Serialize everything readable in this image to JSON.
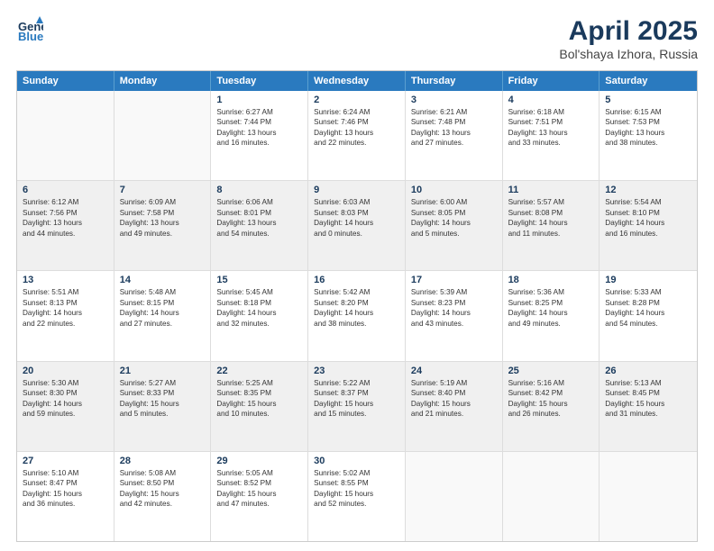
{
  "header": {
    "logo_line1": "General",
    "logo_line2": "Blue",
    "title": "April 2025",
    "subtitle": "Bol'shaya Izhora, Russia"
  },
  "days_of_week": [
    "Sunday",
    "Monday",
    "Tuesday",
    "Wednesday",
    "Thursday",
    "Friday",
    "Saturday"
  ],
  "rows": [
    [
      {
        "day": "",
        "lines": [],
        "empty": true
      },
      {
        "day": "",
        "lines": [],
        "empty": true
      },
      {
        "day": "1",
        "lines": [
          "Sunrise: 6:27 AM",
          "Sunset: 7:44 PM",
          "Daylight: 13 hours",
          "and 16 minutes."
        ]
      },
      {
        "day": "2",
        "lines": [
          "Sunrise: 6:24 AM",
          "Sunset: 7:46 PM",
          "Daylight: 13 hours",
          "and 22 minutes."
        ]
      },
      {
        "day": "3",
        "lines": [
          "Sunrise: 6:21 AM",
          "Sunset: 7:48 PM",
          "Daylight: 13 hours",
          "and 27 minutes."
        ]
      },
      {
        "day": "4",
        "lines": [
          "Sunrise: 6:18 AM",
          "Sunset: 7:51 PM",
          "Daylight: 13 hours",
          "and 33 minutes."
        ]
      },
      {
        "day": "5",
        "lines": [
          "Sunrise: 6:15 AM",
          "Sunset: 7:53 PM",
          "Daylight: 13 hours",
          "and 38 minutes."
        ]
      }
    ],
    [
      {
        "day": "6",
        "lines": [
          "Sunrise: 6:12 AM",
          "Sunset: 7:56 PM",
          "Daylight: 13 hours",
          "and 44 minutes."
        ],
        "shaded": true
      },
      {
        "day": "7",
        "lines": [
          "Sunrise: 6:09 AM",
          "Sunset: 7:58 PM",
          "Daylight: 13 hours",
          "and 49 minutes."
        ],
        "shaded": true
      },
      {
        "day": "8",
        "lines": [
          "Sunrise: 6:06 AM",
          "Sunset: 8:01 PM",
          "Daylight: 13 hours",
          "and 54 minutes."
        ],
        "shaded": true
      },
      {
        "day": "9",
        "lines": [
          "Sunrise: 6:03 AM",
          "Sunset: 8:03 PM",
          "Daylight: 14 hours",
          "and 0 minutes."
        ],
        "shaded": true
      },
      {
        "day": "10",
        "lines": [
          "Sunrise: 6:00 AM",
          "Sunset: 8:05 PM",
          "Daylight: 14 hours",
          "and 5 minutes."
        ],
        "shaded": true
      },
      {
        "day": "11",
        "lines": [
          "Sunrise: 5:57 AM",
          "Sunset: 8:08 PM",
          "Daylight: 14 hours",
          "and 11 minutes."
        ],
        "shaded": true
      },
      {
        "day": "12",
        "lines": [
          "Sunrise: 5:54 AM",
          "Sunset: 8:10 PM",
          "Daylight: 14 hours",
          "and 16 minutes."
        ],
        "shaded": true
      }
    ],
    [
      {
        "day": "13",
        "lines": [
          "Sunrise: 5:51 AM",
          "Sunset: 8:13 PM",
          "Daylight: 14 hours",
          "and 22 minutes."
        ]
      },
      {
        "day": "14",
        "lines": [
          "Sunrise: 5:48 AM",
          "Sunset: 8:15 PM",
          "Daylight: 14 hours",
          "and 27 minutes."
        ]
      },
      {
        "day": "15",
        "lines": [
          "Sunrise: 5:45 AM",
          "Sunset: 8:18 PM",
          "Daylight: 14 hours",
          "and 32 minutes."
        ]
      },
      {
        "day": "16",
        "lines": [
          "Sunrise: 5:42 AM",
          "Sunset: 8:20 PM",
          "Daylight: 14 hours",
          "and 38 minutes."
        ]
      },
      {
        "day": "17",
        "lines": [
          "Sunrise: 5:39 AM",
          "Sunset: 8:23 PM",
          "Daylight: 14 hours",
          "and 43 minutes."
        ]
      },
      {
        "day": "18",
        "lines": [
          "Sunrise: 5:36 AM",
          "Sunset: 8:25 PM",
          "Daylight: 14 hours",
          "and 49 minutes."
        ]
      },
      {
        "day": "19",
        "lines": [
          "Sunrise: 5:33 AM",
          "Sunset: 8:28 PM",
          "Daylight: 14 hours",
          "and 54 minutes."
        ]
      }
    ],
    [
      {
        "day": "20",
        "lines": [
          "Sunrise: 5:30 AM",
          "Sunset: 8:30 PM",
          "Daylight: 14 hours",
          "and 59 minutes."
        ],
        "shaded": true
      },
      {
        "day": "21",
        "lines": [
          "Sunrise: 5:27 AM",
          "Sunset: 8:33 PM",
          "Daylight: 15 hours",
          "and 5 minutes."
        ],
        "shaded": true
      },
      {
        "day": "22",
        "lines": [
          "Sunrise: 5:25 AM",
          "Sunset: 8:35 PM",
          "Daylight: 15 hours",
          "and 10 minutes."
        ],
        "shaded": true
      },
      {
        "day": "23",
        "lines": [
          "Sunrise: 5:22 AM",
          "Sunset: 8:37 PM",
          "Daylight: 15 hours",
          "and 15 minutes."
        ],
        "shaded": true
      },
      {
        "day": "24",
        "lines": [
          "Sunrise: 5:19 AM",
          "Sunset: 8:40 PM",
          "Daylight: 15 hours",
          "and 21 minutes."
        ],
        "shaded": true
      },
      {
        "day": "25",
        "lines": [
          "Sunrise: 5:16 AM",
          "Sunset: 8:42 PM",
          "Daylight: 15 hours",
          "and 26 minutes."
        ],
        "shaded": true
      },
      {
        "day": "26",
        "lines": [
          "Sunrise: 5:13 AM",
          "Sunset: 8:45 PM",
          "Daylight: 15 hours",
          "and 31 minutes."
        ],
        "shaded": true
      }
    ],
    [
      {
        "day": "27",
        "lines": [
          "Sunrise: 5:10 AM",
          "Sunset: 8:47 PM",
          "Daylight: 15 hours",
          "and 36 minutes."
        ]
      },
      {
        "day": "28",
        "lines": [
          "Sunrise: 5:08 AM",
          "Sunset: 8:50 PM",
          "Daylight: 15 hours",
          "and 42 minutes."
        ]
      },
      {
        "day": "29",
        "lines": [
          "Sunrise: 5:05 AM",
          "Sunset: 8:52 PM",
          "Daylight: 15 hours",
          "and 47 minutes."
        ]
      },
      {
        "day": "30",
        "lines": [
          "Sunrise: 5:02 AM",
          "Sunset: 8:55 PM",
          "Daylight: 15 hours",
          "and 52 minutes."
        ]
      },
      {
        "day": "",
        "lines": [],
        "empty": true
      },
      {
        "day": "",
        "lines": [],
        "empty": true
      },
      {
        "day": "",
        "lines": [],
        "empty": true
      }
    ]
  ]
}
